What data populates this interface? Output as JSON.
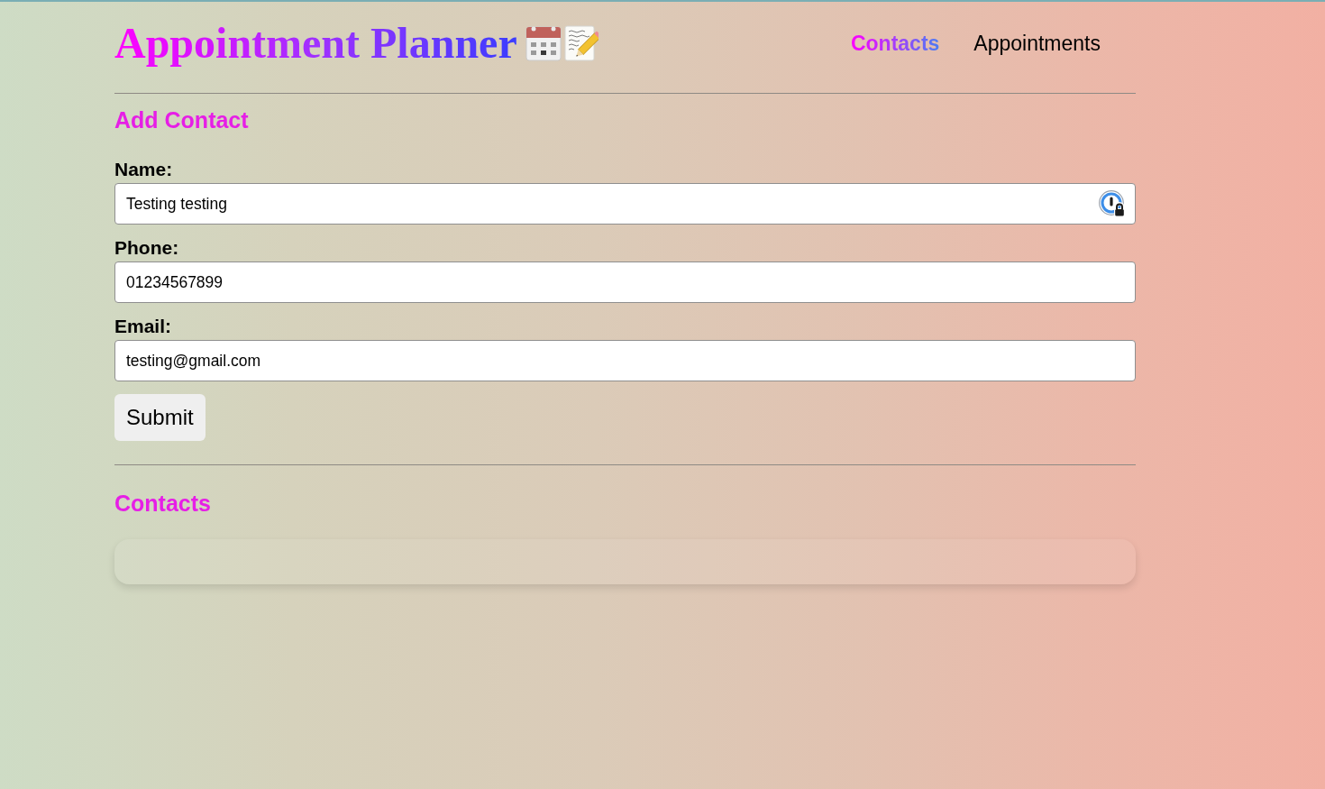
{
  "header": {
    "title": "Appointment Planner",
    "nav": [
      {
        "label": "Contacts",
        "selected": true
      },
      {
        "label": "Appointments",
        "selected": false
      }
    ]
  },
  "add_contact": {
    "heading": "Add Contact",
    "fields": [
      {
        "label": "Name:",
        "value": "Testing testing",
        "password_manager_icon": true
      },
      {
        "label": "Phone:",
        "value": "01234567899",
        "password_manager_icon": false
      },
      {
        "label": "Email:",
        "value": "testing@gmail.com",
        "password_manager_icon": false
      }
    ],
    "submit": "Submit"
  },
  "contacts": {
    "heading": "Contacts"
  }
}
